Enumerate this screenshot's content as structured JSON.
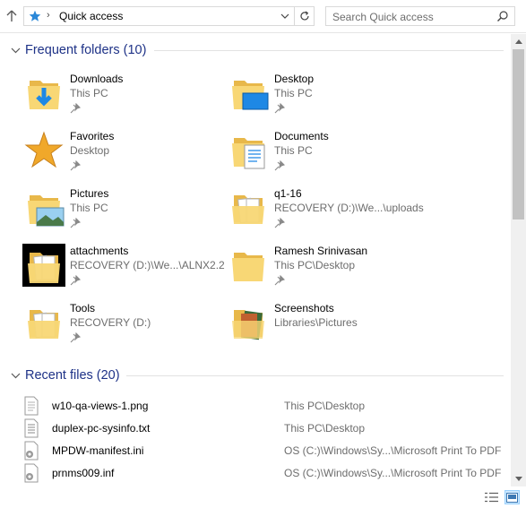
{
  "address_bar": {
    "location": "Quick access",
    "search_placeholder": "Search Quick access"
  },
  "frequent": {
    "header": "Frequent folders (10)",
    "folders": [
      {
        "name": "Downloads",
        "path": "This PC",
        "icon": "downloads-folder-icon"
      },
      {
        "name": "Desktop",
        "path": "This PC",
        "icon": "desktop-folder-icon"
      },
      {
        "name": "Favorites",
        "path": "Desktop",
        "icon": "favorites-star-icon"
      },
      {
        "name": "Documents",
        "path": "This PC",
        "icon": "documents-folder-icon"
      },
      {
        "name": "Pictures",
        "path": "This PC",
        "icon": "pictures-folder-icon"
      },
      {
        "name": "q1-16",
        "path": "RECOVERY (D:)\\We...\\uploads",
        "icon": "folder-icon"
      },
      {
        "name": "attachments",
        "path": "RECOVERY (D:)\\We...\\ALNX2.2",
        "icon": "folder-icon"
      },
      {
        "name": "Ramesh Srinivasan",
        "path": "This PC\\Desktop",
        "icon": "folder-icon"
      },
      {
        "name": "Tools",
        "path": "RECOVERY (D:)",
        "icon": "folder-icon"
      },
      {
        "name": "Screenshots",
        "path": "Libraries\\Pictures",
        "icon": "folder-icon"
      }
    ]
  },
  "recent": {
    "header": "Recent files (20)",
    "files": [
      {
        "name": "w10-qa-views-1.png",
        "location": "This PC\\Desktop",
        "icon": "image-file-icon"
      },
      {
        "name": "duplex-pc-sysinfo.txt",
        "location": "This PC\\Desktop",
        "icon": "text-file-icon"
      },
      {
        "name": "MPDW-manifest.ini",
        "location": "OS (C:)\\Windows\\Sy...\\Microsoft Print To PDF",
        "icon": "settings-file-icon"
      },
      {
        "name": "prnms009.inf",
        "location": "OS (C:)\\Windows\\Sy...\\Microsoft Print To PDF",
        "icon": "settings-file-icon"
      }
    ]
  },
  "colors": {
    "group_header": "#1e3287",
    "secondary_text": "#6d6d6d",
    "folder_yellow": "#f8d775",
    "accent_blue": "#1e88e5"
  }
}
